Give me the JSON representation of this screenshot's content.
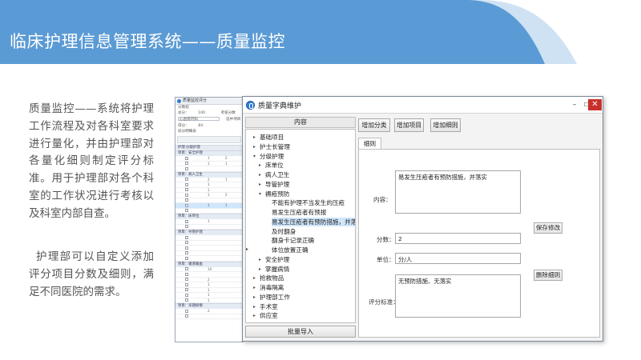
{
  "header": {
    "title": "临床护理信息管理系统——质量监控",
    "bg_color": "#5b9bd5",
    "stripe_color": "#cfe2f3"
  },
  "description": {
    "paragraph1": "质量监控——系统将护理工作流程及对各科室要求进行量化，并由护理部对各量化细则制定评分标准。用于护理部对各个科室的工作状况进行考核以及科室内部自查。",
    "paragraph2": "护理部可以自定义添加评分项目分数及细则，满足不同医院的需求。"
  },
  "background_window": {
    "title": "质量监控评分",
    "lines": [
      "分数组",
      "总分：",
      "100",
      "考核分数",
      "心血管内科",
      "选中项目",
      "得分：",
      "84",
      "扣分明细表"
    ],
    "groups": [
      "护理·分级护理",
      "项目：安全护理",
      "项目：病人卫生",
      "项目：床单位",
      "项目：导管护理",
      "项目：输液输血",
      "项目：早期病情"
    ],
    "row_numbers": [
      "1",
      "2",
      "1",
      "1",
      "2",
      "1",
      "1",
      "1",
      "1",
      "2",
      "1",
      "1",
      "1",
      "10",
      "2",
      "1",
      "1",
      "1",
      "1",
      "2"
    ]
  },
  "dialog": {
    "title": "质量字典维护",
    "controls": {
      "minimize": "–",
      "maximize": "☐",
      "close": "✕"
    },
    "tree_header": "内容",
    "tree": [
      {
        "label": "基础项目",
        "level": 1,
        "arrow": "▸"
      },
      {
        "label": "护士长管理",
        "level": 1,
        "arrow": "▸"
      },
      {
        "label": "分级护理",
        "level": 1,
        "arrow": "▾"
      },
      {
        "label": "床单位",
        "level": 2,
        "arrow": "▸"
      },
      {
        "label": "病人卫生",
        "level": 2,
        "arrow": "▸"
      },
      {
        "label": "导管护理",
        "level": 2,
        "arrow": "▸"
      },
      {
        "label": "褥疮预防",
        "level": 2,
        "arrow": "▾"
      },
      {
        "label": "不能有护理不当发生的压疮",
        "level": 3,
        "arrow": ""
      },
      {
        "label": "易发生压疮者有预报",
        "level": 3,
        "arrow": ""
      },
      {
        "label": "易发生压疮者有预防措施，并落实",
        "level": 3,
        "arrow": "",
        "selected": true
      },
      {
        "label": "及时翻身",
        "level": 3,
        "arrow": ""
      },
      {
        "label": "翻身卡记录正确",
        "level": 3,
        "arrow": ""
      },
      {
        "label": "体位放置正确",
        "level": 3,
        "arrow": ""
      },
      {
        "label": "安全护理",
        "level": 2,
        "arrow": "▸"
      },
      {
        "label": "掌握病情",
        "level": 2,
        "arrow": "▸"
      },
      {
        "label": "抢救物品",
        "level": 1,
        "arrow": "▸"
      },
      {
        "label": "消毒隔离",
        "level": 1,
        "arrow": "▸"
      },
      {
        "label": "护理部工作",
        "level": 1,
        "arrow": "▸"
      },
      {
        "label": "手术室",
        "level": 1,
        "arrow": "▸"
      },
      {
        "label": "供应室",
        "level": 1,
        "arrow": "▸"
      }
    ],
    "batch_import_label": "批量导入",
    "buttons": {
      "add_category": "增加分类",
      "add_item": "增加项目",
      "add_detail": "增加细则",
      "save_changes": "保存修改",
      "delete_detail": "删除细则"
    },
    "tab_label": "细则",
    "form": {
      "content_label": "内容：",
      "content_value": "易发生压疮者有预防措施，并落实",
      "score_label": "分数：",
      "score_value": "2",
      "unit_label": "单位：",
      "unit_value": "分/人",
      "criteria_label": "评分标准：",
      "criteria_value": "无预防措施、无落实"
    }
  }
}
